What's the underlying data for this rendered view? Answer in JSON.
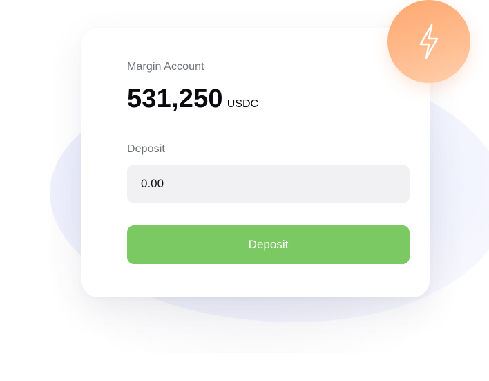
{
  "margin_account": {
    "label": "Margin Account",
    "balance": "531,250",
    "unit": "USDC"
  },
  "deposit": {
    "label": "Deposit",
    "input_placeholder": "0.00",
    "button_label": "Deposit"
  },
  "badge": {
    "icon": "lightning-bolt-icon"
  },
  "colors": {
    "button": "#7ac963",
    "badge": "#fea86f",
    "input_background": "#f1f1f3"
  }
}
